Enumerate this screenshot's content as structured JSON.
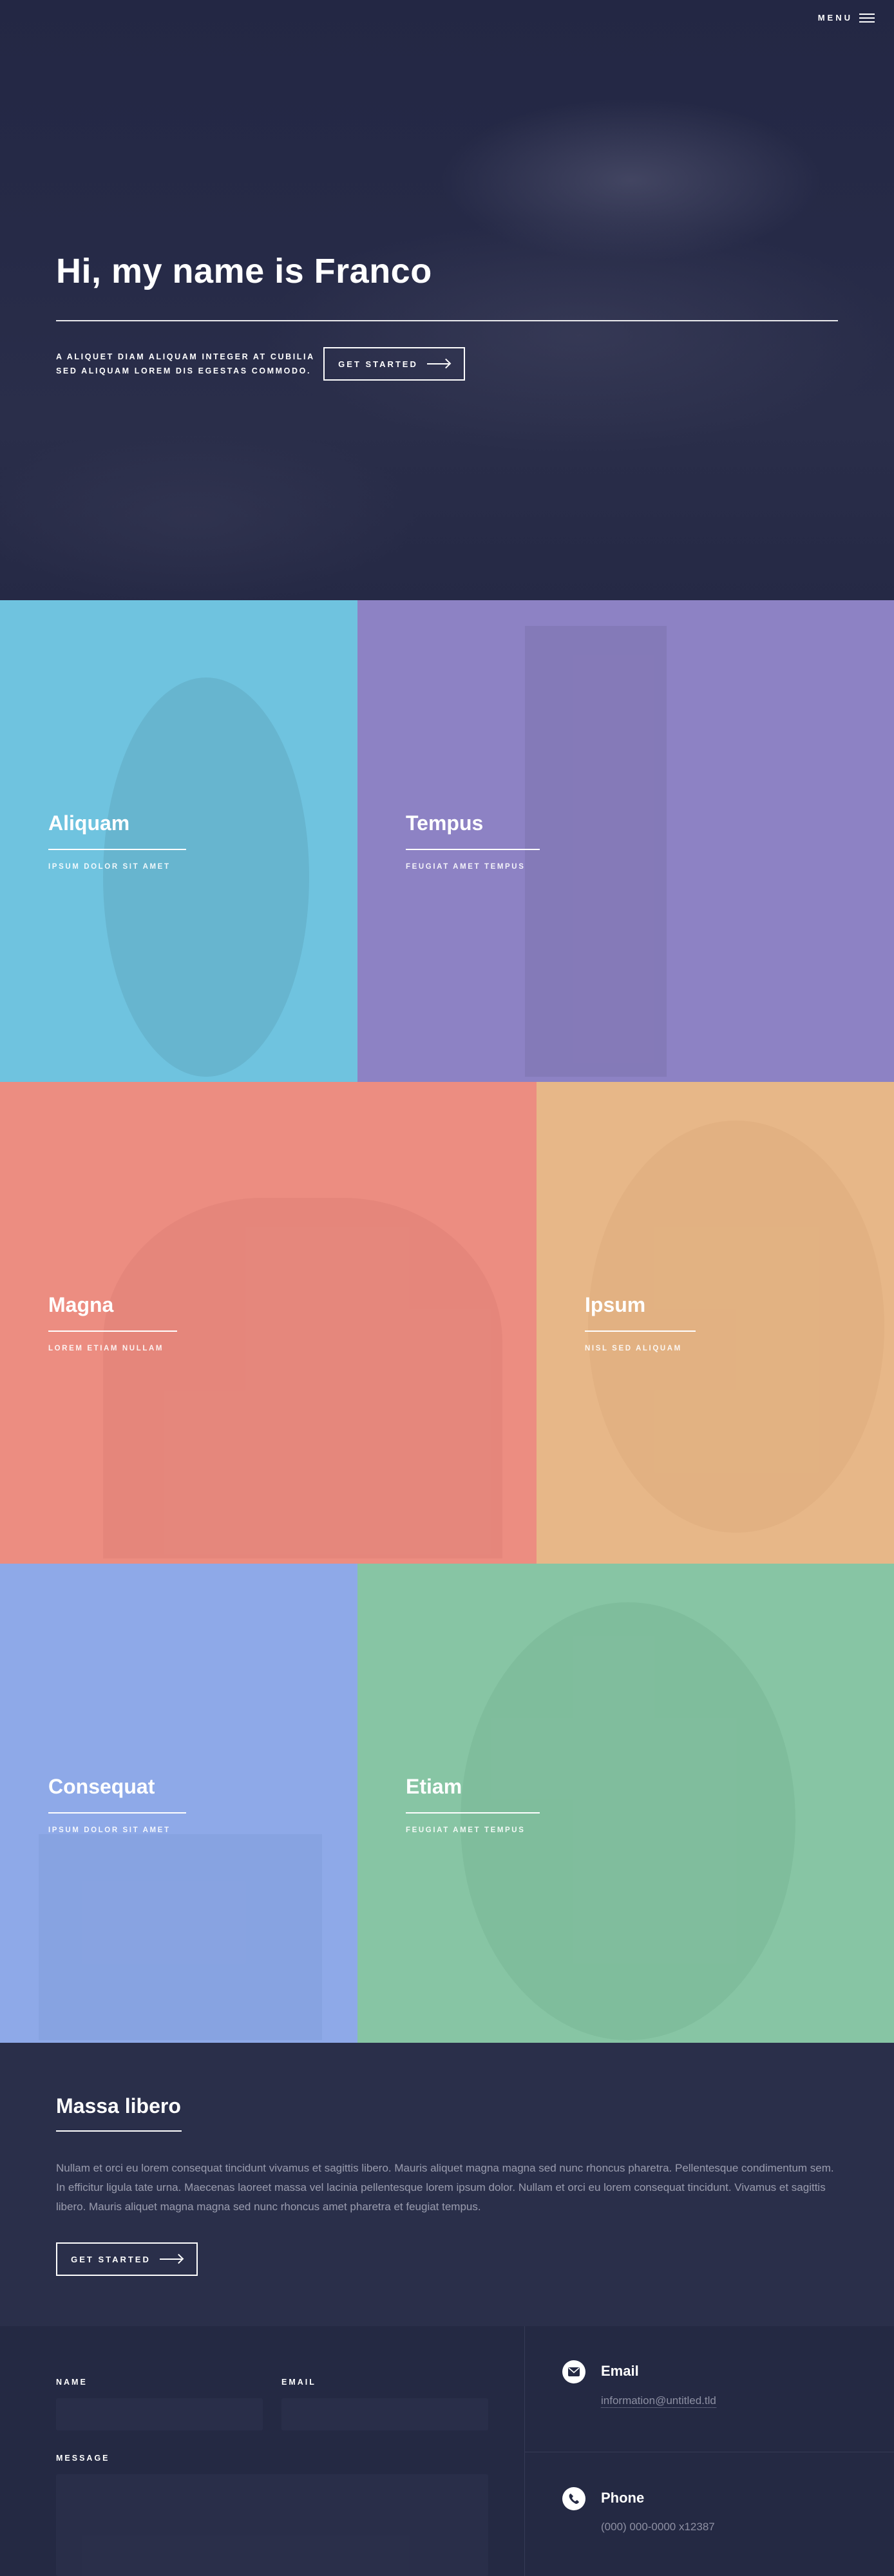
{
  "header": {
    "menu_label": "MENU"
  },
  "hero": {
    "title": "Hi, my name is Franco",
    "text_line1": "A ALIQUET DIAM ALIQUAM INTEGER AT CUBILIA",
    "text_line2": "SED ALIQUAM LOREM DIS EGESTAS COMMODO.",
    "button_label": "GET STARTED"
  },
  "tiles": [
    {
      "title": "Aliquam",
      "subtitle": "IPSUM DOLOR SIT AMET",
      "color": "#6fc3df"
    },
    {
      "title": "Tempus",
      "subtitle": "FEUGIAT AMET TEMPUS",
      "color": "#8d82c4"
    },
    {
      "title": "Magna",
      "subtitle": "LOREM ETIAM NULLAM",
      "color": "#ec8d81"
    },
    {
      "title": "Ipsum",
      "subtitle": "NISL SED ALIQUAM",
      "color": "#e7b788"
    },
    {
      "title": "Consequat",
      "subtitle": "IPSUM DOLOR SIT AMET",
      "color": "#8ea9e8"
    },
    {
      "title": "Etiam",
      "subtitle": "FEUGIAT AMET TEMPUS",
      "color": "#87c5a4"
    }
  ],
  "massa": {
    "title": "Massa libero",
    "paragraph": "Nullam et orci eu lorem consequat tincidunt vivamus et sagittis libero. Mauris aliquet magna magna sed nunc rhoncus pharetra. Pellentesque condimentum sem. In efficitur ligula tate urna. Maecenas laoreet massa vel lacinia pellentesque lorem ipsum dolor. Nullam et orci eu lorem consequat tincidunt. Vivamus et sagittis libero. Mauris aliquet magna magna sed nunc rhoncus amet pharetra et feugiat tempus.",
    "button_label": "GET STARTED"
  },
  "contact": {
    "name_label": "NAME",
    "email_label": "EMAIL",
    "message_label": "MESSAGE",
    "email_title": "Email",
    "email_value": "information@untitled.tld",
    "phone_title": "Phone",
    "phone_value": "(000) 000-0000 x12387"
  },
  "colors": {
    "background": "#242943",
    "section": "#2a2f4a",
    "accent": "#ffffff"
  },
  "icons": {
    "menu": "hamburger-icon",
    "email": "envelope-icon",
    "phone": "phone-icon",
    "button": "arrow-right-icon"
  }
}
